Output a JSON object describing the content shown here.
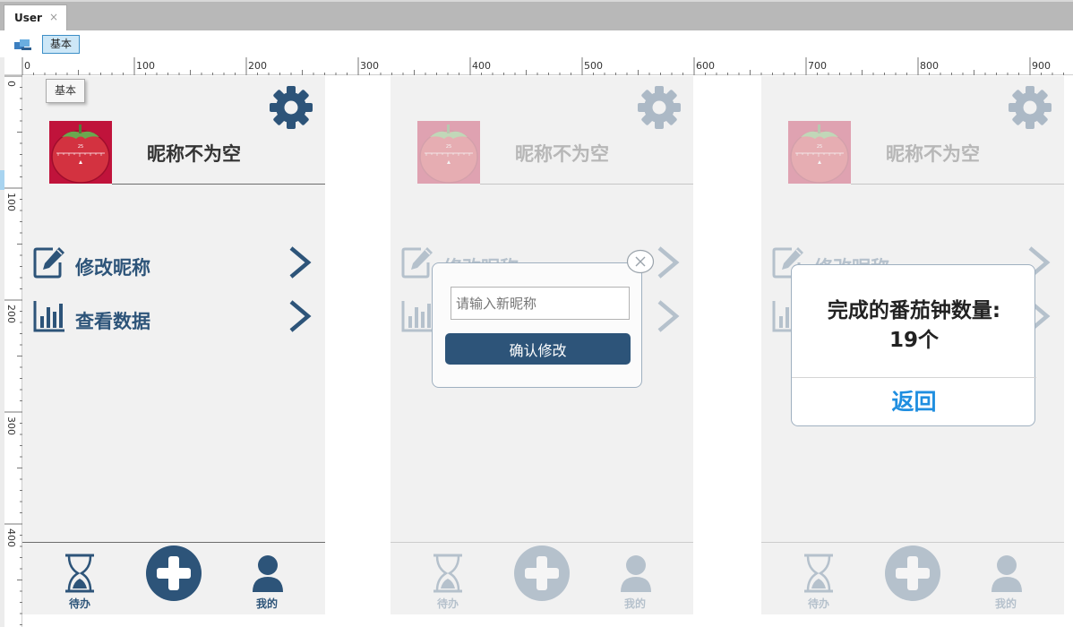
{
  "window": {
    "tab_title": "User",
    "tab_close": "×"
  },
  "toolbar": {
    "view_label": "基本"
  },
  "ruler": {
    "h_marks": [
      "0",
      "100",
      "200",
      "300",
      "400",
      "500",
      "600",
      "700",
      "800",
      "900"
    ],
    "v_marks": [
      "0",
      "100",
      "200",
      "300",
      "400"
    ]
  },
  "tooltip": "基本",
  "screens": {
    "profile": {
      "nickname": "昵称不为空",
      "menu": [
        {
          "label": "修改昵称"
        },
        {
          "label": "查看数据"
        }
      ],
      "nav": {
        "todo": "待办",
        "me": "我的"
      }
    }
  },
  "rename_dialog": {
    "placeholder": "请输入新昵称",
    "confirm_label": "确认修改"
  },
  "stats_dialog": {
    "line1": "完成的番茄钟数量:",
    "line2": "19个",
    "back_label": "返回"
  },
  "colors": {
    "primary": "#2d5479",
    "avatar_bg": "#c0133b",
    "link_blue": "#1f8ee0",
    "frame_bg": "#f1f1f1"
  },
  "icons": [
    "gear-icon",
    "tomato-timer-icon",
    "edit-icon",
    "bar-chart-icon",
    "chevron-right-icon",
    "hourglass-icon",
    "plus-circle-icon",
    "user-icon",
    "close-icon"
  ]
}
